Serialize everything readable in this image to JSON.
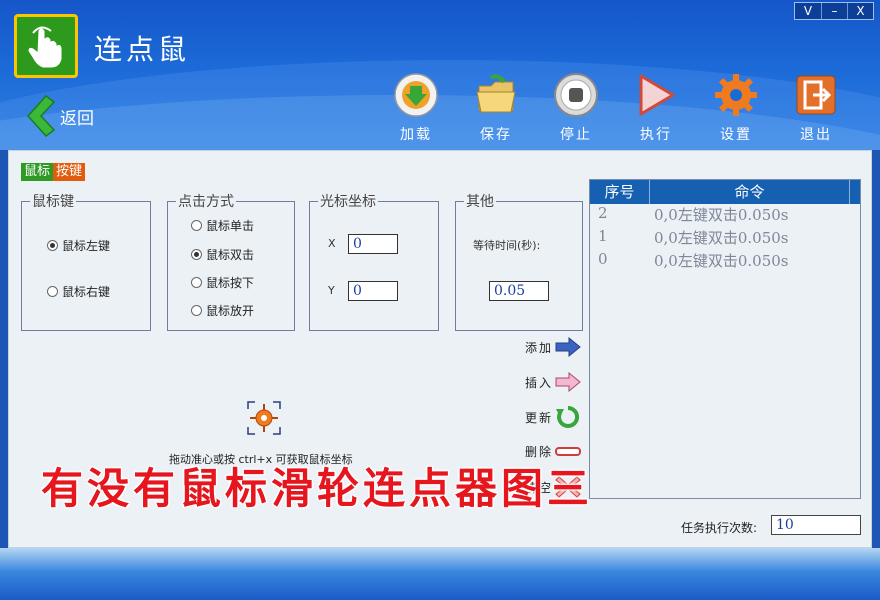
{
  "window": {
    "controls": [
      "V",
      "–",
      "X"
    ],
    "title": "连点鼠"
  },
  "nav": {
    "back_label": "返回"
  },
  "toolbar": [
    {
      "id": "load",
      "label": "加载",
      "icon": "download-icon"
    },
    {
      "id": "save",
      "label": "保存",
      "icon": "folder-icon"
    },
    {
      "id": "stop",
      "label": "停止",
      "icon": "stop-icon"
    },
    {
      "id": "run",
      "label": "执行",
      "icon": "play-icon"
    },
    {
      "id": "settings",
      "label": "设置",
      "icon": "gear-icon"
    },
    {
      "id": "exit",
      "label": "退出",
      "icon": "exit-icon"
    }
  ],
  "tag": {
    "part1": "鼠标",
    "part2": "按键"
  },
  "mouse_button": {
    "legend": "鼠标键",
    "options": [
      "鼠标左键",
      "鼠标右键"
    ],
    "selected": "鼠标左键"
  },
  "click_mode": {
    "legend": "点击方式",
    "options": [
      "鼠标单击",
      "鼠标双击",
      "鼠标按下",
      "鼠标放开"
    ],
    "selected": "鼠标双击"
  },
  "cursor_coords": {
    "legend": "光标坐标",
    "x_label": "X",
    "y_label": "Y",
    "x_value": "0",
    "y_value": "0"
  },
  "other": {
    "legend": "其他",
    "wait_label": "等待时间(秒):",
    "wait_value": "0.05"
  },
  "hint": "拖动准心或按 ctrl+x 可获取鼠标坐标",
  "actions": [
    "添加",
    "插入",
    "更新",
    "删除",
    "清空"
  ],
  "commands": {
    "headers": [
      "序号",
      "命令"
    ],
    "rows": [
      {
        "index": "2",
        "command": "0,0左键双击0.050s"
      },
      {
        "index": "1",
        "command": "0,0左键双击0.050s"
      },
      {
        "index": "0",
        "command": "0,0左键双击0.050s"
      }
    ]
  },
  "task_count": {
    "label": "任务执行次数:",
    "value": "10"
  },
  "overlay_text": "有没有鼠标滑轮连点器图三",
  "colors": {
    "accent": "#1560b0",
    "overlay": "#e5161d"
  }
}
